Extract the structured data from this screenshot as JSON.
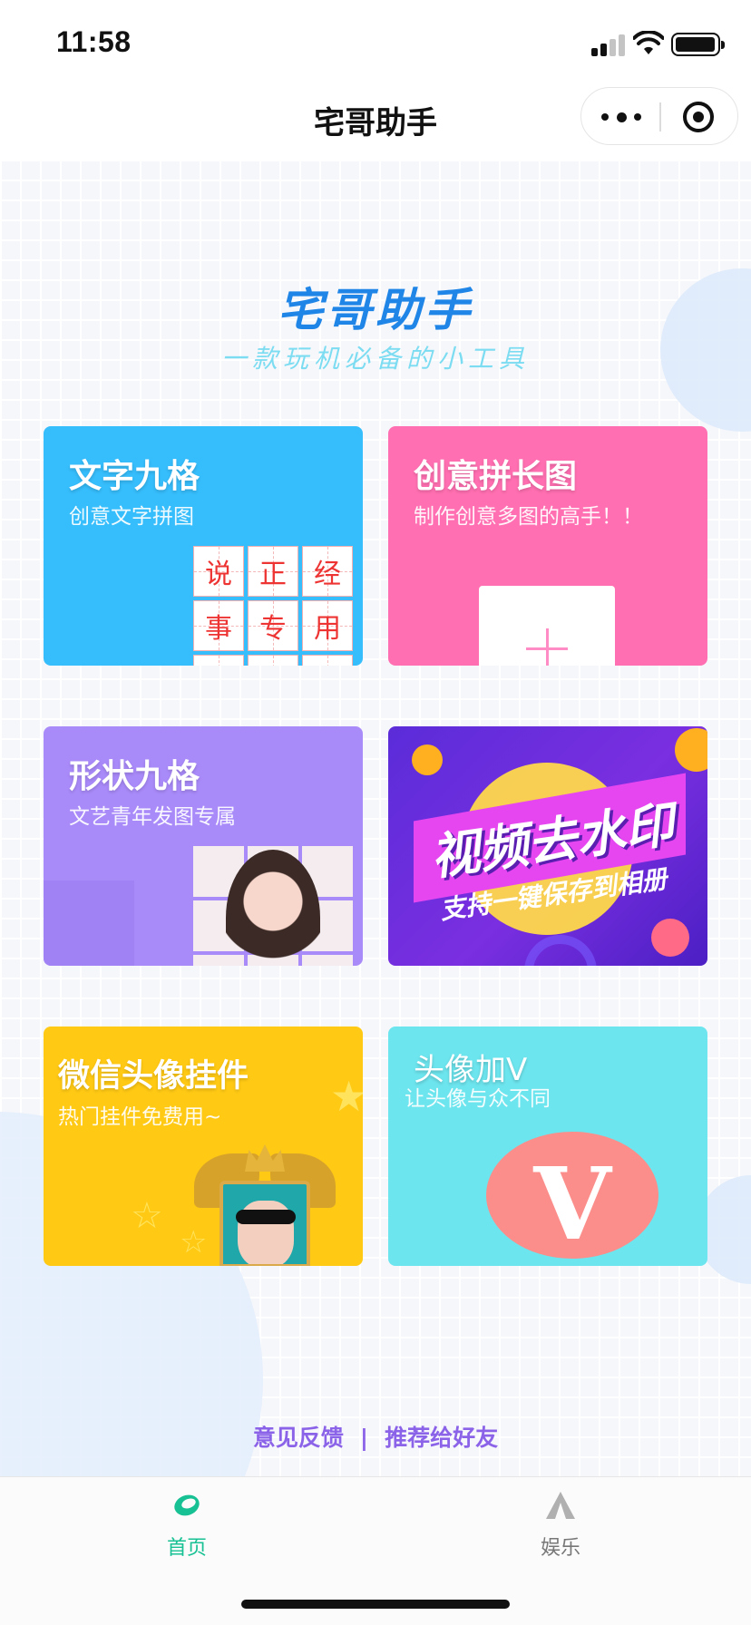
{
  "status_bar": {
    "time": "11:58",
    "signal_icon": "signal-icon",
    "wifi_icon": "wifi-icon",
    "battery_icon": "battery-icon"
  },
  "nav": {
    "title": "宅哥助手",
    "more_icon": "more-dots-icon",
    "close_icon": "target-circle-icon"
  },
  "hero": {
    "title": "宅哥助手",
    "subtitle": "一款玩机必备的小工具",
    "title_color": "#1f86e8",
    "subtitle_color": "#7cdcf1"
  },
  "cards": [
    {
      "title": "文字九格",
      "subtitle": "创意文字拼图",
      "color": "#36bdfb",
      "grid_chars": [
        "说",
        "正",
        "经",
        "事",
        "专",
        "用",
        "",
        "",
        ""
      ]
    },
    {
      "title": "创意拼长图",
      "subtitle": "制作创意多图的高手！！",
      "color": "#ff6fb1"
    },
    {
      "title": "形状九格",
      "subtitle": "文艺青年发图专属",
      "color": "#a98af9"
    },
    {
      "title": "视频去水印",
      "subtitle": "支持一键保存到相册",
      "color": "#5b2cd9"
    },
    {
      "title": "微信头像挂件",
      "subtitle": "热门挂件免费用~",
      "color": "#ffc914"
    },
    {
      "title": "头像加V",
      "subtitle": "让头像与众不同",
      "badge": "V",
      "color": "#6de5ee"
    }
  ],
  "footer": {
    "feedback": "意见反馈",
    "separator": "|",
    "share": "推荐给好友",
    "color": "#8b63e8"
  },
  "tabs": [
    {
      "label": "首页",
      "icon": "home-leaf-icon",
      "active": true,
      "color": "#17c193"
    },
    {
      "label": "娱乐",
      "icon": "tent-icon",
      "active": false,
      "color": "#777777"
    }
  ]
}
